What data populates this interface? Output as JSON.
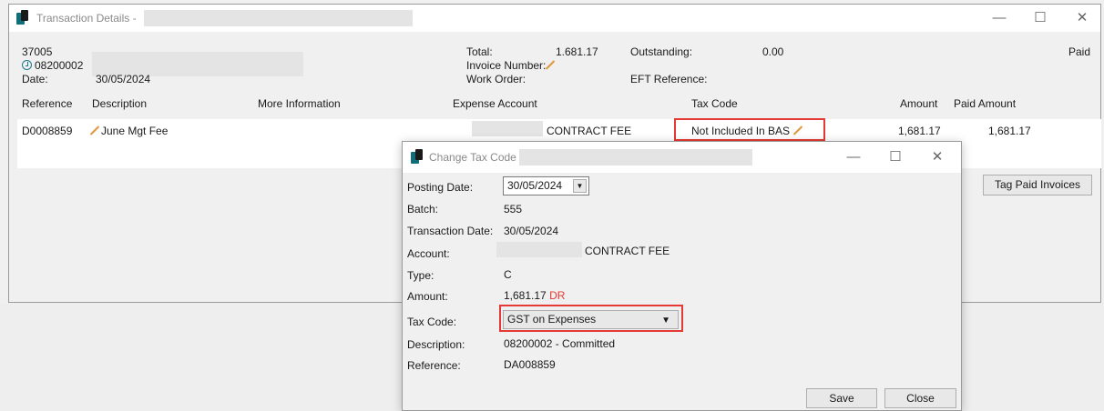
{
  "main_window": {
    "title": "Transaction Details -",
    "controls": {
      "minimize": "—",
      "maximize": "☐",
      "close": "✕"
    },
    "header": {
      "reference_id": "37005",
      "creditor_code": "08200002",
      "date_label": "Date:",
      "date_value": "30/05/2024",
      "total_label": "Total:",
      "total_value": "1.681.17",
      "invoice_number_label": "Invoice Number:",
      "work_order_label": "Work Order:",
      "outstanding_label": "Outstanding:",
      "outstanding_value": "0.00",
      "eft_reference_label": "EFT Reference:",
      "status": "Paid"
    },
    "table": {
      "columns": [
        "Reference",
        "Description",
        "More Information",
        "Expense Account",
        "Tax Code",
        "Amount",
        "Paid Amount"
      ],
      "rows": [
        {
          "reference": "D0008859",
          "description": "June Mgt Fee",
          "more_information": "",
          "expense_account": "CONTRACT FEE",
          "tax_code": "Not Included In BAS",
          "amount": "1,681.17",
          "paid_amount": "1,681.17"
        }
      ]
    },
    "tag_paid_invoices_label": "Tag Paid Invoices"
  },
  "dialog": {
    "title": "Change Tax Code -",
    "controls": {
      "minimize": "—",
      "maximize": "☐",
      "close": "✕"
    },
    "posting_date_label": "Posting Date:",
    "posting_date_value": "30/05/2024",
    "batch_label": "Batch:",
    "batch_value": "555",
    "transaction_date_label": "Transaction Date:",
    "transaction_date_value": "30/05/2024",
    "account_label": "Account:",
    "account_value": "CONTRACT FEE",
    "type_label": "Type:",
    "type_value": "C",
    "amount_label": "Amount:",
    "amount_value": "1,681.17",
    "amount_suffix": "DR",
    "tax_code_label": "Tax Code:",
    "tax_code_value": "GST on Expenses",
    "description_label": "Description:",
    "description_value": "08200002 - Committed",
    "reference_label": "Reference:",
    "reference_value": "DA008859",
    "save_label": "Save",
    "close_label": "Close"
  },
  "colors": {
    "highlight": "#e53935",
    "accent": "#1a7a8a",
    "suffix_red": "#e53935"
  }
}
